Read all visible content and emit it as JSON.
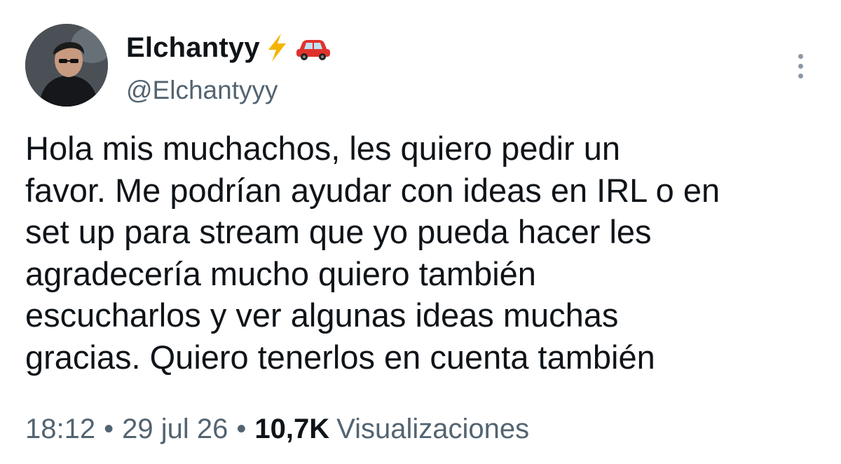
{
  "author": {
    "display_name": "Elchantyy",
    "badges": [
      "lightning-emoji",
      "red-car-emoji"
    ],
    "handle": "@Elchantyyy"
  },
  "tweet": {
    "lines": [
      "Hola mis muchachos, les quiero pedir un",
      "favor. Me podrían ayudar con ideas en IRL o en",
      "set up para stream que yo pueda hacer les",
      "agradecería mucho quiero también",
      "escucharlos y ver algunas ideas muchas",
      "gracias. Quiero tenerlos en cuenta también"
    ]
  },
  "meta": {
    "time": "18:12",
    "separator": "•",
    "date": "29 jul 26",
    "views_count": "10,7K",
    "views_label": "Visualizaciones"
  },
  "icons": {
    "more": "more-vertical-icon"
  },
  "colors": {
    "text_primary": "#0f1419",
    "text_secondary": "#536471",
    "lightning": "#f5b400",
    "car": "#e0322d"
  }
}
